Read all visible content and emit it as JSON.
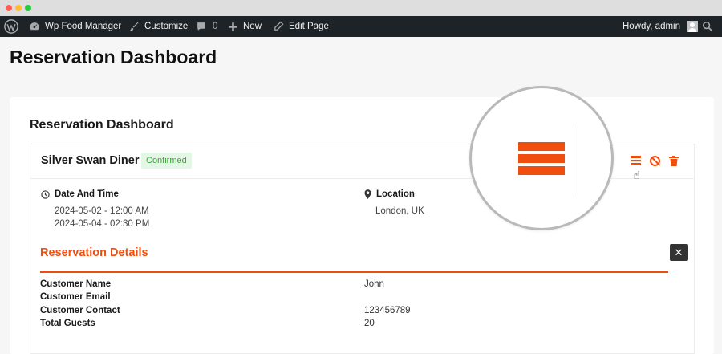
{
  "admin_bar": {
    "site_name": "Wp Food Manager",
    "customize": "Customize",
    "comments_count": "0",
    "new": "New",
    "edit_page": "Edit Page",
    "howdy": "Howdy, admin"
  },
  "page": {
    "title": "Reservation Dashboard"
  },
  "dashboard": {
    "title": "Reservation Dashboard",
    "reservation": {
      "restaurant": "Silver Swan Diner",
      "status": "Confirmed",
      "date_time_label": "Date And Time",
      "date_start": "2024-05-02 - 12:00 AM",
      "date_end": "2024-05-04 - 02:30 PM",
      "location_label": "Location",
      "location": "London, UK"
    },
    "details": {
      "title": "Reservation Details",
      "rows": [
        {
          "label": "Customer Name",
          "value": "John"
        },
        {
          "label": "Customer Email",
          "value": ""
        },
        {
          "label": "Customer Contact",
          "value": "123456789"
        },
        {
          "label": "Total Guests",
          "value": "20"
        }
      ]
    }
  },
  "icons": {
    "actions": [
      "menu-icon",
      "cancel-icon",
      "trash-icon"
    ],
    "accent_color": "#f04e0f",
    "status_color": "#3aa63a"
  }
}
